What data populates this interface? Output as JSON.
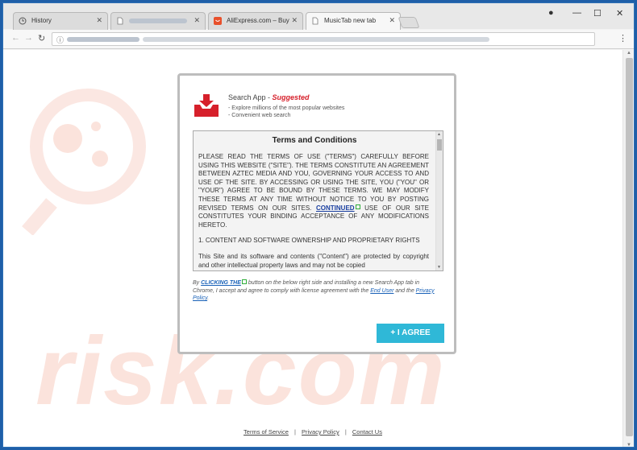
{
  "browser": {
    "tabs": [
      {
        "label": "History",
        "icon": "history-icon"
      },
      {
        "label": "",
        "icon": "page-icon",
        "blurred": true
      },
      {
        "label": "AliExpress.com – Buy ch",
        "icon": "aliexpress-icon"
      },
      {
        "label": "MusicTab new tab",
        "icon": "page-icon",
        "active": true
      }
    ],
    "window_controls": {
      "profile": "●",
      "minimize": "—",
      "maximize": "☐",
      "close": "✕"
    },
    "toolbar": {
      "back": "←",
      "forward": "→",
      "reload": "↻",
      "menu": "⋮",
      "info": "ⓘ"
    }
  },
  "dialog": {
    "app_name": "Search App",
    "dash": " - ",
    "suggested": "Suggested",
    "features": [
      "- Explore millions of the most popular websites",
      "- Convenient web search"
    ],
    "terms_title": "Terms and Conditions",
    "terms_p1_before": "PLEASE READ THE TERMS OF USE (\"TERMS\") CAREFULLY BEFORE USING THIS WEBSITE (\"SITE\"). THE TERMS CONSTITUTE AN AGREEMENT BETWEEN AZTEC MEDIA AND YOU, GOVERNING YOUR ACCESS TO AND USE OF THE SITE. BY ACCESSING OR USING THE SITE, YOU (\"YOU\" OR \"YOUR\") AGREE TO BE BOUND BY THESE TERMS. WE MAY MODIFY THESE TERMS AT ANY TIME WITHOUT NOTICE TO YOU BY POSTING REVISED TERMS ON OUR SITES. ",
    "terms_p1_link": "CONTINUED",
    "terms_p1_after": " USE OF OUR SITE CONSTITUTES YOUR BINDING ACCEPTANCE OF ANY MODIFICATIONS HERETO.",
    "terms_p2": "1. CONTENT AND SOFTWARE OWNERSHIP AND PROPRIETARY RIGHTS",
    "terms_p3": "This Site and its software and contents (\"Content\") are protected by copyright and other intellectual property laws and may not be copied",
    "consent_by": "By ",
    "consent_link": "CLICKING THE",
    "consent_rest": " button on the below right side and installing a new Search App tab in Chrome, I accept and agree to comply with license agreement with the ",
    "consent_end_user": "End User",
    "consent_and": " and the ",
    "consent_privacy": "Privacy Policy",
    "consent_dot": ".",
    "agree_button": "+ I AGREE"
  },
  "footer": {
    "links": [
      "Terms of Service",
      "Privacy Policy",
      "Contact Us"
    ],
    "separator": "|"
  },
  "watermark": "risk.com",
  "colors": {
    "accent": "#2fb8d7",
    "suggested": "#d6202b",
    "link": "#1a62b8",
    "icon_red": "#d6202b"
  }
}
